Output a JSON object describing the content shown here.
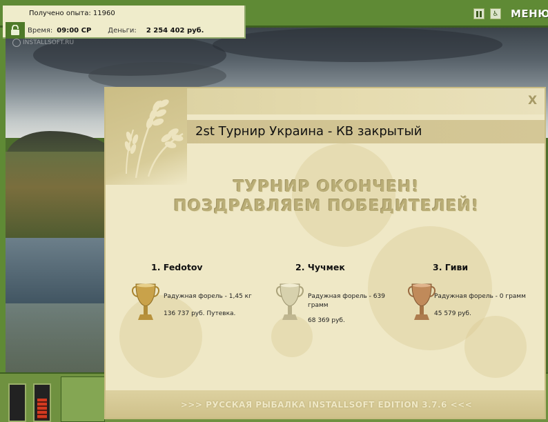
{
  "hud": {
    "experience_label": "Получено опыта:",
    "experience_value": "11960",
    "time_label": "Время:",
    "time_value": "09:00 СР",
    "money_label": "Деньги:",
    "money_value": "2 254 402 руб."
  },
  "watermark": "INSTALLSOFT.RU",
  "controls": {
    "menu_label": "МЕНЮ",
    "pause_icon": "pause-icon",
    "accessibility_icon": "wheelchair-icon"
  },
  "dialog": {
    "title": "2st Турнир Украина - КВ закрытый",
    "close_label": "X",
    "heading_line1": "ТУРНИР ОКОНЧЕН!",
    "heading_line2": "ПОЗДРАВЛЯЕМ ПОБЕДИТЕЛЕЙ!",
    "winners": [
      {
        "name": "1. Fedotov",
        "catch": "Радужная форель - 1,45 кг",
        "prize": "136 737 руб. Путевка.",
        "cup": "gold"
      },
      {
        "name": "2. Чучмек",
        "catch": "Радужная форель - 639 грамм",
        "prize": "68 369 руб.",
        "cup": "silver"
      },
      {
        "name": "3. Гиви",
        "catch": "Радужная форель - 0 грамм",
        "prize": "45 579 руб.",
        "cup": "bronze"
      }
    ],
    "footer": ">>> РУССКАЯ РЫБАЛКА INSTALLSOFT EDITION 3.7.6 <<<"
  },
  "colors": {
    "frame_green": "#5f8a35",
    "dialog_bg": "#efe8c6",
    "heading_color": "#b9ad76",
    "gold": "#c9a24a",
    "silver": "#c8c4a8",
    "bronze": "#c08a5a"
  }
}
